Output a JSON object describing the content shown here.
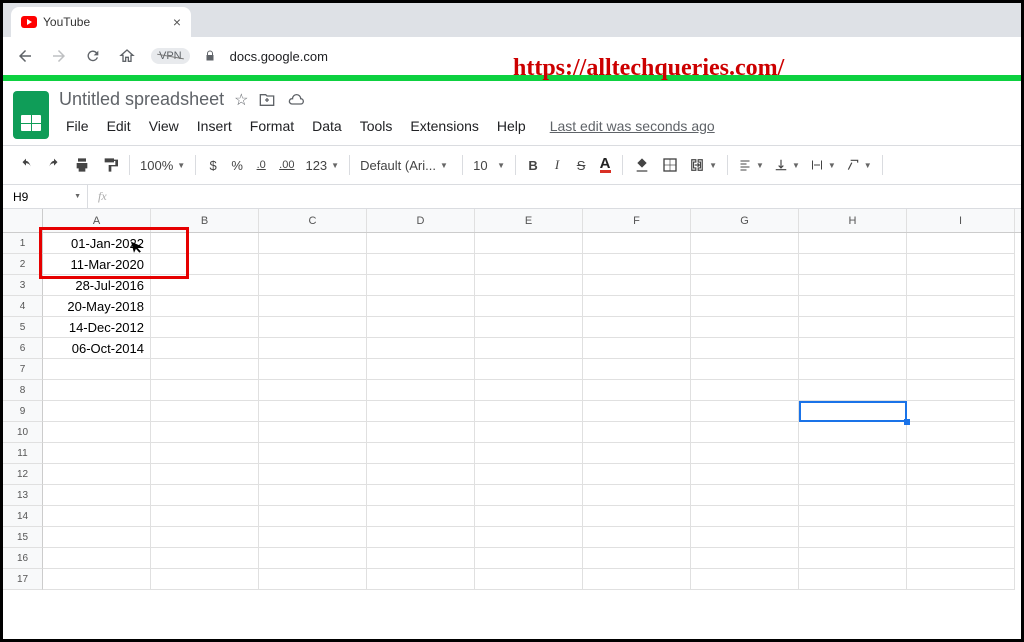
{
  "browser": {
    "tab_title": "YouTube",
    "vpn_label": "VPN",
    "url": "docs.google.com"
  },
  "watermark": "https://alltechqueries.com/",
  "sheets": {
    "title": "Untitled spreadsheet",
    "menus": [
      "File",
      "Edit",
      "View",
      "Insert",
      "Format",
      "Data",
      "Tools",
      "Extensions",
      "Help"
    ],
    "last_edit": "Last edit was seconds ago"
  },
  "toolbar": {
    "zoom": "100%",
    "currency": "$",
    "percent": "%",
    "dec_dec": ".0",
    "inc_dec": ".00",
    "more_fmt": "123",
    "font": "Default (Ari...",
    "font_size": "10",
    "bold": "B",
    "italic": "I",
    "strike": "S",
    "text_color": "A"
  },
  "fx": {
    "name_box": "H9",
    "fx_label": "fx"
  },
  "columns": [
    "A",
    "B",
    "C",
    "D",
    "E",
    "F",
    "G",
    "H",
    "I"
  ],
  "row_numbers": [
    "1",
    "2",
    "3",
    "4",
    "5",
    "6",
    "7",
    "8",
    "9",
    "10",
    "11",
    "12",
    "13",
    "14",
    "15",
    "16",
    "17"
  ],
  "cells": {
    "A1": "01-Jan-2022",
    "A2": "11-Mar-2020",
    "A3": "28-Jul-2016",
    "A4": "20-May-2018",
    "A5": "14-Dec-2012",
    "A6": "06-Oct-2014"
  },
  "selected_cell": "H9"
}
